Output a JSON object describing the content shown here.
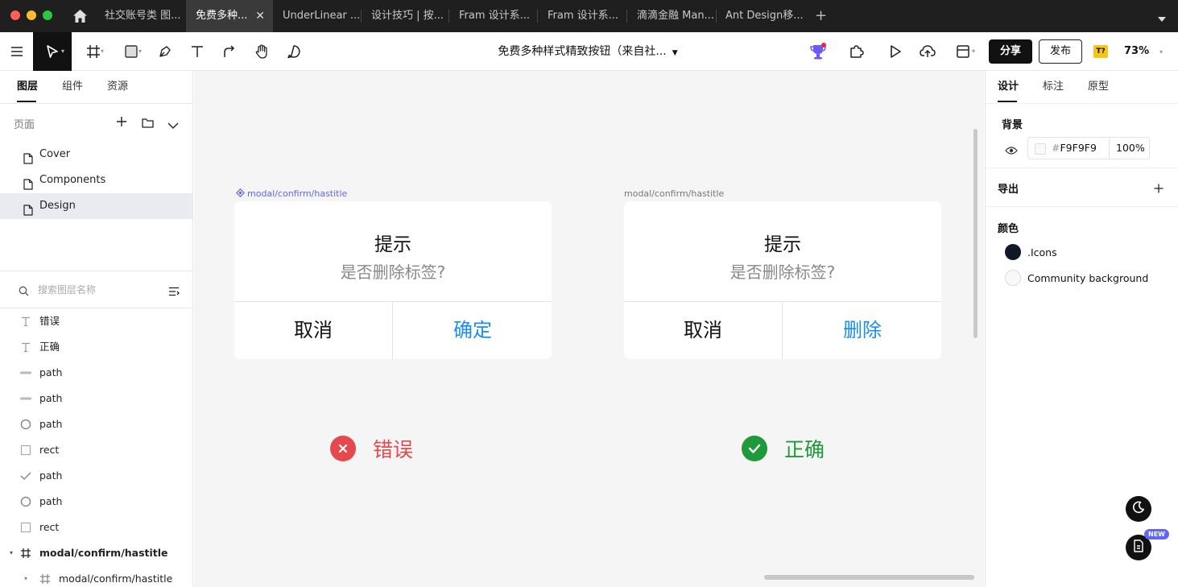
{
  "browser": {
    "tabs": [
      {
        "label": "社交账号类 图..."
      },
      {
        "label": "免费多种...",
        "active": true
      },
      {
        "label": "UnderLinear ..."
      },
      {
        "label": "设计技巧 | 按..."
      },
      {
        "label": "Fram 设计系..."
      },
      {
        "label": "Fram 设计系..."
      },
      {
        "label": "滴滴金融 Man..."
      },
      {
        "label": "Ant Design移..."
      }
    ]
  },
  "toolbar": {
    "document_title": "免费多种样式精致按钮（来自社...",
    "share_label": "分享",
    "publish_label": "发布",
    "plugin_badge": "T?",
    "zoom": "73%"
  },
  "left_panel": {
    "tabs": [
      "图层",
      "组件",
      "资源"
    ],
    "pages_label": "页面",
    "pages": [
      "Cover",
      "Components",
      "Design"
    ],
    "selected_page": "Design",
    "search_placeholder": "搜索图层名称",
    "layers": [
      {
        "name": "错误",
        "icon": "text-icon"
      },
      {
        "name": "正确",
        "icon": "text-icon"
      },
      {
        "name": "path",
        "icon": "line-icon"
      },
      {
        "name": "path",
        "icon": "line-icon"
      },
      {
        "name": "path",
        "icon": "circle-icon"
      },
      {
        "name": "rect",
        "icon": "rect-icon"
      },
      {
        "name": "path",
        "icon": "check-icon"
      },
      {
        "name": "path",
        "icon": "circle-icon"
      },
      {
        "name": "rect",
        "icon": "rect-icon"
      },
      {
        "name": "modal/confirm/hastitle",
        "icon": "frame-icon",
        "bold": true
      },
      {
        "name": "modal/confirm/hastitle",
        "icon": "frame-icon"
      }
    ]
  },
  "canvas": {
    "frames": [
      {
        "label": "modal/confirm/hastitle",
        "is_component": true,
        "title": "提示",
        "message": "是否删除标签?",
        "cancel": "取消",
        "confirm": "确定"
      },
      {
        "label": "modal/confirm/hastitle",
        "is_component": false,
        "title": "提示",
        "message": "是否删除标签?",
        "cancel": "取消",
        "confirm": "删除"
      }
    ],
    "wrong": {
      "label": "错误",
      "color": "#e5484d"
    },
    "right": {
      "label": "正确",
      "color": "#1e9a3a"
    },
    "confirm_color": "#1a8ef0"
  },
  "right_panel": {
    "tabs": [
      "设计",
      "标注",
      "原型"
    ],
    "background_label": "背景",
    "background_hex": "F9F9F9",
    "background_opacity": "100%",
    "export_label": "导出",
    "colors_label": "颜色",
    "colors": [
      {
        "name": ".Icons",
        "hex": "#111827"
      },
      {
        "name": "Community background",
        "hex": "#F9F9F9"
      }
    ]
  },
  "floating": {
    "new_badge": "NEW"
  }
}
